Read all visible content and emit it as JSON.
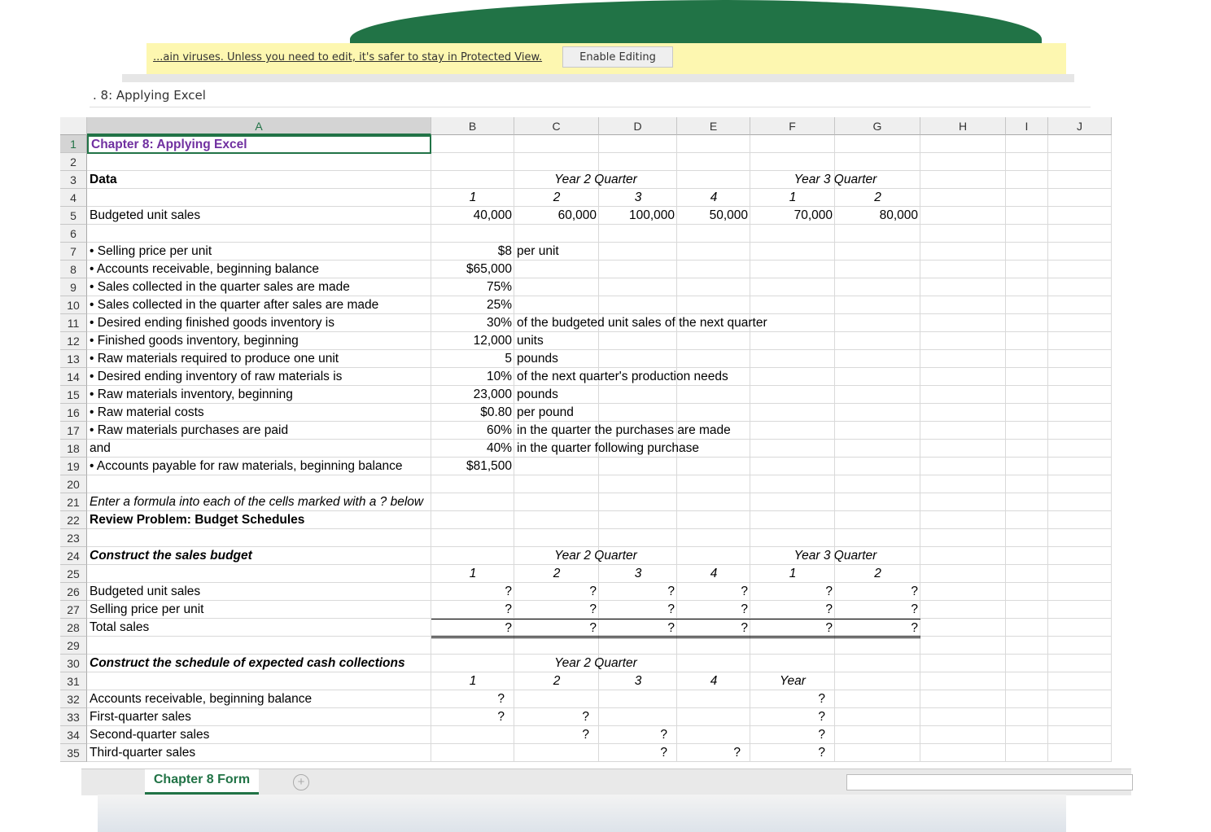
{
  "protected_view": {
    "message": "...ain viruses. Unless you need to edit, it's safer to stay in Protected View.",
    "enable_button": "Enable Editing"
  },
  "name_box": ". 8: Applying Excel",
  "columns": [
    "A",
    "B",
    "C",
    "D",
    "E",
    "F",
    "G",
    "H",
    "I",
    "J"
  ],
  "sheet_tab": "Chapter 8 Form",
  "add_sheet": "+",
  "rows": [
    {
      "n": 1,
      "cells": {
        "A": "Chapter 8: Applying Excel"
      }
    },
    {
      "n": 2,
      "cells": {}
    },
    {
      "n": 3,
      "cells": {
        "A": "Data",
        "CD": "Year 2 Quarter",
        "FG": "Year 3 Quarter"
      }
    },
    {
      "n": 4,
      "cells": {
        "B": "1",
        "C": "2",
        "D": "3",
        "E": "4",
        "F": "1",
        "G": "2"
      }
    },
    {
      "n": 5,
      "cells": {
        "A": "Budgeted unit sales",
        "B": "40,000",
        "C": "60,000",
        "D": "100,000",
        "E": "50,000",
        "F": "70,000",
        "G": "80,000"
      }
    },
    {
      "n": 6,
      "cells": {}
    },
    {
      "n": 7,
      "cells": {
        "A": "• Selling price per unit",
        "B": "$8",
        "C": "per unit"
      }
    },
    {
      "n": 8,
      "cells": {
        "A": "• Accounts receivable, beginning balance",
        "B": "$65,000"
      }
    },
    {
      "n": 9,
      "cells": {
        "A": "• Sales collected in the quarter sales are made",
        "B": "75%"
      }
    },
    {
      "n": 10,
      "cells": {
        "A": "• Sales collected in the quarter after sales are made",
        "B": "25%"
      }
    },
    {
      "n": 11,
      "cells": {
        "A": "• Desired ending finished goods inventory is",
        "B": "30%",
        "C": "of the budgeted unit sales of the next quarter"
      }
    },
    {
      "n": 12,
      "cells": {
        "A": "• Finished goods inventory, beginning",
        "B": "12,000",
        "C": "units"
      }
    },
    {
      "n": 13,
      "cells": {
        "A": "• Raw materials required to produce one unit",
        "B": "5",
        "C": "pounds"
      }
    },
    {
      "n": 14,
      "cells": {
        "A": "• Desired ending inventory of raw materials is",
        "B": "10%",
        "C": "of the next quarter's production needs"
      }
    },
    {
      "n": 15,
      "cells": {
        "A": "• Raw materials inventory, beginning",
        "B": "23,000",
        "C": "pounds"
      }
    },
    {
      "n": 16,
      "cells": {
        "A": "• Raw material costs",
        "B": "$0.80",
        "C": "per pound"
      }
    },
    {
      "n": 17,
      "cells": {
        "A": "• Raw materials purchases are paid",
        "B": "60%",
        "C": "in the quarter the purchases are made"
      }
    },
    {
      "n": 18,
      "cells": {
        "A": "     and",
        "B": "40%",
        "C": "in the quarter following purchase"
      }
    },
    {
      "n": 19,
      "cells": {
        "A": "• Accounts payable for raw materials, beginning balance",
        "B": "$81,500"
      }
    },
    {
      "n": 20,
      "cells": {}
    },
    {
      "n": 21,
      "cells": {
        "A": "Enter a formula into each of the cells marked with a ? below"
      }
    },
    {
      "n": 22,
      "cells": {
        "A": "Review Problem: Budget Schedules"
      }
    },
    {
      "n": 23,
      "cells": {}
    },
    {
      "n": 24,
      "cells": {
        "A": "Construct the sales budget",
        "CD": "Year 2 Quarter",
        "FG": "Year 3 Quarter"
      }
    },
    {
      "n": 25,
      "cells": {
        "B": "1",
        "C": "2",
        "D": "3",
        "E": "4",
        "F": "1",
        "G": "2"
      }
    },
    {
      "n": 26,
      "cells": {
        "A": "Budgeted unit sales",
        "B": "?",
        "C": "?",
        "D": "?",
        "E": "?",
        "F": "?",
        "G": "?"
      }
    },
    {
      "n": 27,
      "cells": {
        "A": "Selling price per unit",
        "B": "?",
        "C": "?",
        "D": "?",
        "E": "?",
        "F": "?",
        "G": "?"
      }
    },
    {
      "n": 28,
      "cells": {
        "A": "Total sales",
        "B": "?",
        "C": "?",
        "D": "?",
        "E": "?",
        "F": "?",
        "G": "?"
      }
    },
    {
      "n": 29,
      "cells": {}
    },
    {
      "n": 30,
      "cells": {
        "A": "Construct the schedule of expected cash collections",
        "CD": "Year 2 Quarter"
      }
    },
    {
      "n": 31,
      "cells": {
        "B": "1",
        "C": "2",
        "D": "3",
        "E": "4",
        "F": "Year"
      }
    },
    {
      "n": 32,
      "cells": {
        "A": "Accounts receivable, beginning balance",
        "B": "?",
        "F": "?"
      }
    },
    {
      "n": 33,
      "cells": {
        "A": "First-quarter sales",
        "B": "?",
        "C": "?",
        "F": "?"
      }
    },
    {
      "n": 34,
      "cells": {
        "A": "Second-quarter sales",
        "C": "?",
        "D": "?",
        "F": "?"
      }
    },
    {
      "n": 35,
      "cells": {
        "A": "Third-quarter sales",
        "D": "?",
        "E": "?",
        "F": "?"
      }
    }
  ],
  "colors": {
    "excel_green": "#217346",
    "title_purple": "#7030a0",
    "protected_yellow": "#fdf7b0"
  }
}
